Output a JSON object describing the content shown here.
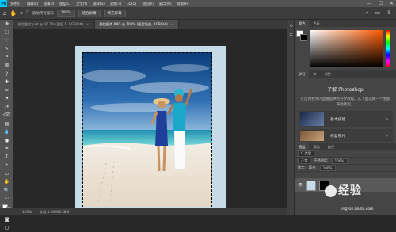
{
  "app": {
    "logo": "Ps"
  },
  "menu": [
    "文件(F)",
    "编辑(E)",
    "图像(I)",
    "图层(L)",
    "文字(Y)",
    "选择(S)",
    "滤镜(T)",
    "3D(D)",
    "视图(V)",
    "窗口(W)",
    "帮助(H)"
  ],
  "window_controls": [
    "—",
    "☐",
    "✕"
  ],
  "options": {
    "tool_icon": "hand-icon",
    "checkbox": "☐",
    "scroll_all": "滚动所有窗口",
    "zoom": "100%",
    "fit_screen": "适合屏幕",
    "fill_screen": "填充屏幕"
  },
  "tabs": [
    {
      "label": "微信图片.psd @ 66.7% (图层 1, RGB/8#)",
      "active": false
    },
    {
      "label": "微信图片.PNG @ 100% (图层填充, RGB/8#)",
      "active": true
    }
  ],
  "status": {
    "zoom": "100%",
    "doc": "文档:1.26M/3.38M"
  },
  "panels": {
    "color_tabs": [
      "颜色",
      "色板"
    ],
    "learn_tabs": [
      "学习",
      "库",
      "调整"
    ],
    "learn_title": "了解 Photoshop",
    "learn_text": "在应用程序内直接提供的分步教程。从下面选择一个主题开始教程。",
    "cards": [
      "基本技能",
      "修复照片"
    ],
    "layer_tabs": [
      "图层",
      "通道",
      "路径"
    ],
    "layer_kind": "Q 类型",
    "blend_mode": "正常",
    "opacity_label": "不透明度:",
    "opacity": "100%",
    "lock_label": "锁定:",
    "fill_label": "填充:",
    "fill": "100%"
  },
  "watermark": {
    "text": "经验",
    "url": "jingyan.baidu.com"
  }
}
